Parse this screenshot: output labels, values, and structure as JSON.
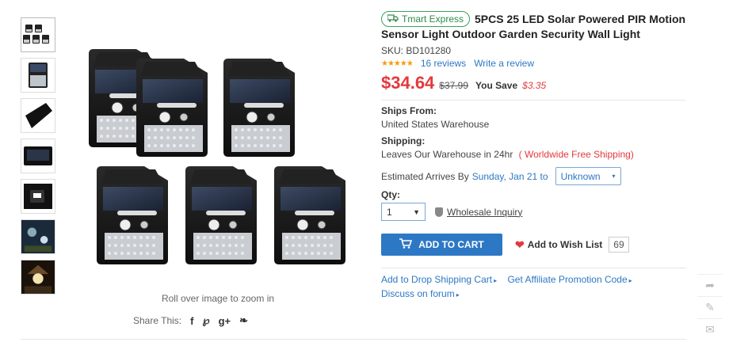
{
  "thumbnails": [
    {
      "icon": "five-lights-thumb"
    },
    {
      "icon": "single-light-thumb"
    },
    {
      "icon": "side-view-thumb"
    },
    {
      "icon": "top-view-thumb"
    },
    {
      "icon": "lit-light-thumb"
    },
    {
      "icon": "garden-night-thumb"
    },
    {
      "icon": "night-scene-thumb"
    }
  ],
  "image": {
    "zoom_hint": "Roll over image to zoom in"
  },
  "share": {
    "label": "Share This:",
    "icons": [
      "facebook-icon",
      "pinterest-icon",
      "google-plus-icon",
      "twitter-icon"
    ],
    "glyphs": [
      "f",
      "℘",
      "g+",
      "❧"
    ]
  },
  "product": {
    "badge": "Tmart Express",
    "title": "5PCS 25 LED Solar Powered PIR Motion Sensor Light Outdoor Garden Security Wall Light",
    "sku_label": "SKU:",
    "sku": "BD101280",
    "stars": "★★★★★",
    "reviews": "16 reviews",
    "write_review": "Write a review",
    "price": "$34.64",
    "old_price": "$37.99",
    "save_label": "You Save",
    "save_value": "$3.35"
  },
  "shipping": {
    "ships_from_label": "Ships From:",
    "ships_from": "United States Warehouse",
    "shipping_label": "Shipping:",
    "shipping_text": "Leaves Our Warehouse in 24hr",
    "free_shipping": "( Worldwide Free Shipping)",
    "arrives_label": "Estimated Arrives By",
    "arrives_date": "Sunday, Jan 21 to",
    "arrives_select": "Unknown"
  },
  "purchase": {
    "qty_label": "Qty:",
    "qty_value": "1",
    "wholesale": "Wholesale Inquiry",
    "add_to_cart": "ADD TO CART",
    "wish_label": "Add to Wish List",
    "wish_count": "69"
  },
  "links": {
    "drop_ship": "Add to Drop Shipping Cart",
    "affiliate": "Get Affiliate Promotion Code",
    "forum": "Discuss on forum"
  },
  "colors": {
    "accent_blue": "#2d78c4",
    "price_red": "#e4393c",
    "express_green": "#2e8b4a",
    "star_orange": "#f39c12"
  }
}
